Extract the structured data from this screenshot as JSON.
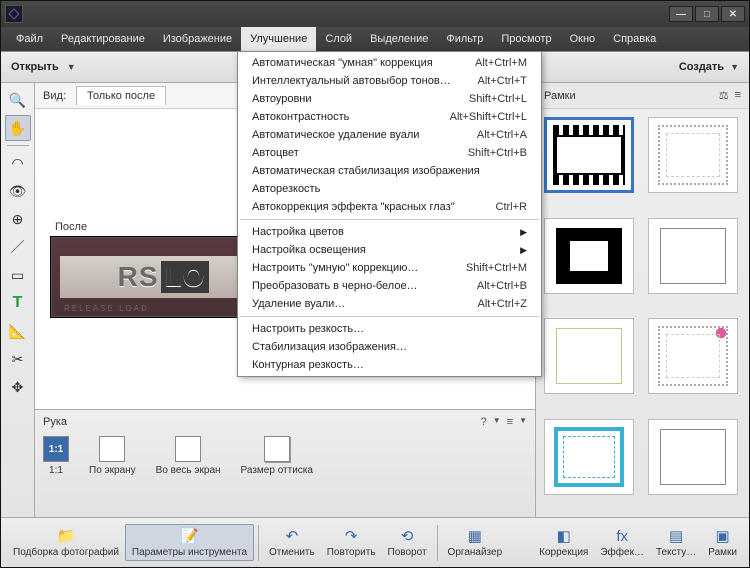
{
  "titlebar": {
    "minimize": "—",
    "maximize": "□",
    "close": "✕"
  },
  "menubar": [
    "Файл",
    "Редактирование",
    "Изображение",
    "Улучшение",
    "Слой",
    "Выделение",
    "Фильтр",
    "Просмотр",
    "Окно",
    "Справка"
  ],
  "menu_active_index": 3,
  "secondbar": {
    "open": "Открыть",
    "create": "Создать"
  },
  "viewbar": {
    "label": "Вид:",
    "tab": "Только после"
  },
  "canvas": {
    "label": "После",
    "logo_a": "RS",
    "logo_b": "LO",
    "sub": "RELEASE LOAD"
  },
  "hand_panel": {
    "title": "Рука",
    "help": "?",
    "menu": "≡",
    "thumbs": [
      {
        "icon": "1:1",
        "label": "1:1",
        "style": "blue"
      },
      {
        "icon": "",
        "label": "По экрану",
        "style": ""
      },
      {
        "icon": "",
        "label": "Во весь экран",
        "style": ""
      },
      {
        "icon": "",
        "label": "Размер оттиска",
        "style": "shadow"
      }
    ]
  },
  "right_panel": {
    "title": "Рамки",
    "balance": "⚖",
    "menu": "≡"
  },
  "bottombar": {
    "left": [
      {
        "icon": "📁",
        "label": "Подборка фотографий"
      },
      {
        "icon": "📝",
        "label": "Параметры инструмента",
        "sel": true
      },
      {
        "icon": "↶",
        "label": "Отменить"
      },
      {
        "icon": "↷",
        "label": "Повторить"
      },
      {
        "icon": "⟲",
        "label": "Поворот"
      },
      {
        "icon": "▦",
        "label": "Органайзер"
      }
    ],
    "right": [
      {
        "icon": "◧",
        "label": "Коррекция"
      },
      {
        "icon": "fx",
        "label": "Эффек…"
      },
      {
        "icon": "▤",
        "label": "Тексту…"
      },
      {
        "icon": "▣",
        "label": "Рамки"
      }
    ]
  },
  "dropdown": {
    "g1": [
      {
        "label": "Автоматическая \"умная\" коррекция",
        "sc": "Alt+Ctrl+M"
      },
      {
        "label": "Интеллектуальный автовыбор тонов…",
        "sc": "Alt+Ctrl+T"
      },
      {
        "label": "Автоуровни",
        "sc": "Shift+Ctrl+L"
      },
      {
        "label": "Автоконтрастность",
        "sc": "Alt+Shift+Ctrl+L"
      },
      {
        "label": "Автоматическое удаление вуали",
        "sc": "Alt+Ctrl+A"
      },
      {
        "label": "Автоцвет",
        "sc": "Shift+Ctrl+B"
      },
      {
        "label": "Автоматическая стабилизация изображения",
        "sc": ""
      },
      {
        "label": "Авторезкость",
        "sc": ""
      },
      {
        "label": "Автокоррекция эффекта \"красных глаз\"",
        "sc": "Ctrl+R"
      }
    ],
    "g2": [
      {
        "label": "Настройка цветов",
        "sub": true
      },
      {
        "label": "Настройка освещения",
        "sub": true
      },
      {
        "label": "Настроить \"умную\" коррекцию…",
        "sc": "Shift+Ctrl+M"
      },
      {
        "label": "Преобразовать в черно-белое…",
        "sc": "Alt+Ctrl+B"
      },
      {
        "label": "Удаление вуали…",
        "sc": "Alt+Ctrl+Z"
      }
    ],
    "g3": [
      {
        "label": "Настроить резкость…"
      },
      {
        "label": "Стабилизация изображения…"
      },
      {
        "label": "Контурная резкость…"
      }
    ]
  },
  "tools": [
    {
      "name": "zoom",
      "glyph": "🔍"
    },
    {
      "name": "hand",
      "glyph": "✋",
      "active": true
    },
    {
      "name": "sep"
    },
    {
      "name": "lasso",
      "glyph": "◠"
    },
    {
      "name": "eye",
      "glyph": "👁"
    },
    {
      "name": "redeye",
      "glyph": "⊕"
    },
    {
      "name": "brush",
      "glyph": "／"
    },
    {
      "name": "ruler",
      "glyph": "▭"
    },
    {
      "name": "type",
      "glyph": "T",
      "color": "#2a9a3a"
    },
    {
      "name": "measure",
      "glyph": "📐"
    },
    {
      "name": "crop",
      "glyph": "✂"
    },
    {
      "name": "move",
      "glyph": "✥"
    }
  ]
}
